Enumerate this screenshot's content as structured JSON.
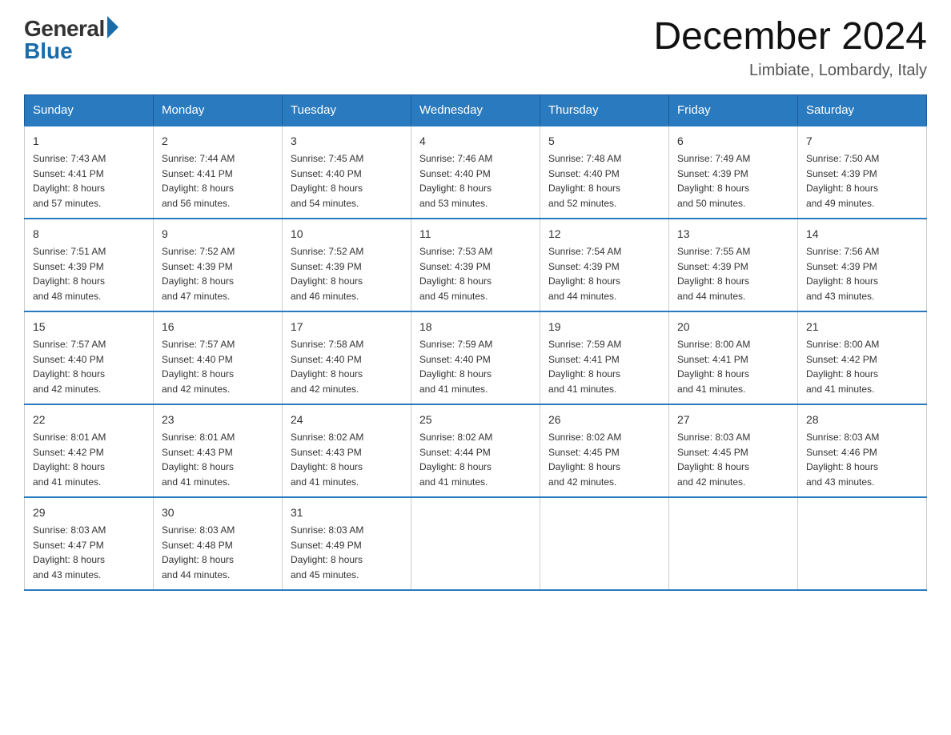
{
  "header": {
    "logo_general": "General",
    "logo_blue": "Blue",
    "month_year": "December 2024",
    "location": "Limbiate, Lombardy, Italy"
  },
  "days_of_week": [
    "Sunday",
    "Monday",
    "Tuesday",
    "Wednesday",
    "Thursday",
    "Friday",
    "Saturday"
  ],
  "weeks": [
    [
      {
        "day": "1",
        "sunrise": "7:43 AM",
        "sunset": "4:41 PM",
        "daylight": "8 hours and 57 minutes."
      },
      {
        "day": "2",
        "sunrise": "7:44 AM",
        "sunset": "4:41 PM",
        "daylight": "8 hours and 56 minutes."
      },
      {
        "day": "3",
        "sunrise": "7:45 AM",
        "sunset": "4:40 PM",
        "daylight": "8 hours and 54 minutes."
      },
      {
        "day": "4",
        "sunrise": "7:46 AM",
        "sunset": "4:40 PM",
        "daylight": "8 hours and 53 minutes."
      },
      {
        "day": "5",
        "sunrise": "7:48 AM",
        "sunset": "4:40 PM",
        "daylight": "8 hours and 52 minutes."
      },
      {
        "day": "6",
        "sunrise": "7:49 AM",
        "sunset": "4:39 PM",
        "daylight": "8 hours and 50 minutes."
      },
      {
        "day": "7",
        "sunrise": "7:50 AM",
        "sunset": "4:39 PM",
        "daylight": "8 hours and 49 minutes."
      }
    ],
    [
      {
        "day": "8",
        "sunrise": "7:51 AM",
        "sunset": "4:39 PM",
        "daylight": "8 hours and 48 minutes."
      },
      {
        "day": "9",
        "sunrise": "7:52 AM",
        "sunset": "4:39 PM",
        "daylight": "8 hours and 47 minutes."
      },
      {
        "day": "10",
        "sunrise": "7:52 AM",
        "sunset": "4:39 PM",
        "daylight": "8 hours and 46 minutes."
      },
      {
        "day": "11",
        "sunrise": "7:53 AM",
        "sunset": "4:39 PM",
        "daylight": "8 hours and 45 minutes."
      },
      {
        "day": "12",
        "sunrise": "7:54 AM",
        "sunset": "4:39 PM",
        "daylight": "8 hours and 44 minutes."
      },
      {
        "day": "13",
        "sunrise": "7:55 AM",
        "sunset": "4:39 PM",
        "daylight": "8 hours and 44 minutes."
      },
      {
        "day": "14",
        "sunrise": "7:56 AM",
        "sunset": "4:39 PM",
        "daylight": "8 hours and 43 minutes."
      }
    ],
    [
      {
        "day": "15",
        "sunrise": "7:57 AM",
        "sunset": "4:40 PM",
        "daylight": "8 hours and 42 minutes."
      },
      {
        "day": "16",
        "sunrise": "7:57 AM",
        "sunset": "4:40 PM",
        "daylight": "8 hours and 42 minutes."
      },
      {
        "day": "17",
        "sunrise": "7:58 AM",
        "sunset": "4:40 PM",
        "daylight": "8 hours and 42 minutes."
      },
      {
        "day": "18",
        "sunrise": "7:59 AM",
        "sunset": "4:40 PM",
        "daylight": "8 hours and 41 minutes."
      },
      {
        "day": "19",
        "sunrise": "7:59 AM",
        "sunset": "4:41 PM",
        "daylight": "8 hours and 41 minutes."
      },
      {
        "day": "20",
        "sunrise": "8:00 AM",
        "sunset": "4:41 PM",
        "daylight": "8 hours and 41 minutes."
      },
      {
        "day": "21",
        "sunrise": "8:00 AM",
        "sunset": "4:42 PM",
        "daylight": "8 hours and 41 minutes."
      }
    ],
    [
      {
        "day": "22",
        "sunrise": "8:01 AM",
        "sunset": "4:42 PM",
        "daylight": "8 hours and 41 minutes."
      },
      {
        "day": "23",
        "sunrise": "8:01 AM",
        "sunset": "4:43 PM",
        "daylight": "8 hours and 41 minutes."
      },
      {
        "day": "24",
        "sunrise": "8:02 AM",
        "sunset": "4:43 PM",
        "daylight": "8 hours and 41 minutes."
      },
      {
        "day": "25",
        "sunrise": "8:02 AM",
        "sunset": "4:44 PM",
        "daylight": "8 hours and 41 minutes."
      },
      {
        "day": "26",
        "sunrise": "8:02 AM",
        "sunset": "4:45 PM",
        "daylight": "8 hours and 42 minutes."
      },
      {
        "day": "27",
        "sunrise": "8:03 AM",
        "sunset": "4:45 PM",
        "daylight": "8 hours and 42 minutes."
      },
      {
        "day": "28",
        "sunrise": "8:03 AM",
        "sunset": "4:46 PM",
        "daylight": "8 hours and 43 minutes."
      }
    ],
    [
      {
        "day": "29",
        "sunrise": "8:03 AM",
        "sunset": "4:47 PM",
        "daylight": "8 hours and 43 minutes."
      },
      {
        "day": "30",
        "sunrise": "8:03 AM",
        "sunset": "4:48 PM",
        "daylight": "8 hours and 44 minutes."
      },
      {
        "day": "31",
        "sunrise": "8:03 AM",
        "sunset": "4:49 PM",
        "daylight": "8 hours and 45 minutes."
      },
      null,
      null,
      null,
      null
    ]
  ],
  "labels": {
    "sunrise": "Sunrise:",
    "sunset": "Sunset:",
    "daylight": "Daylight:"
  }
}
